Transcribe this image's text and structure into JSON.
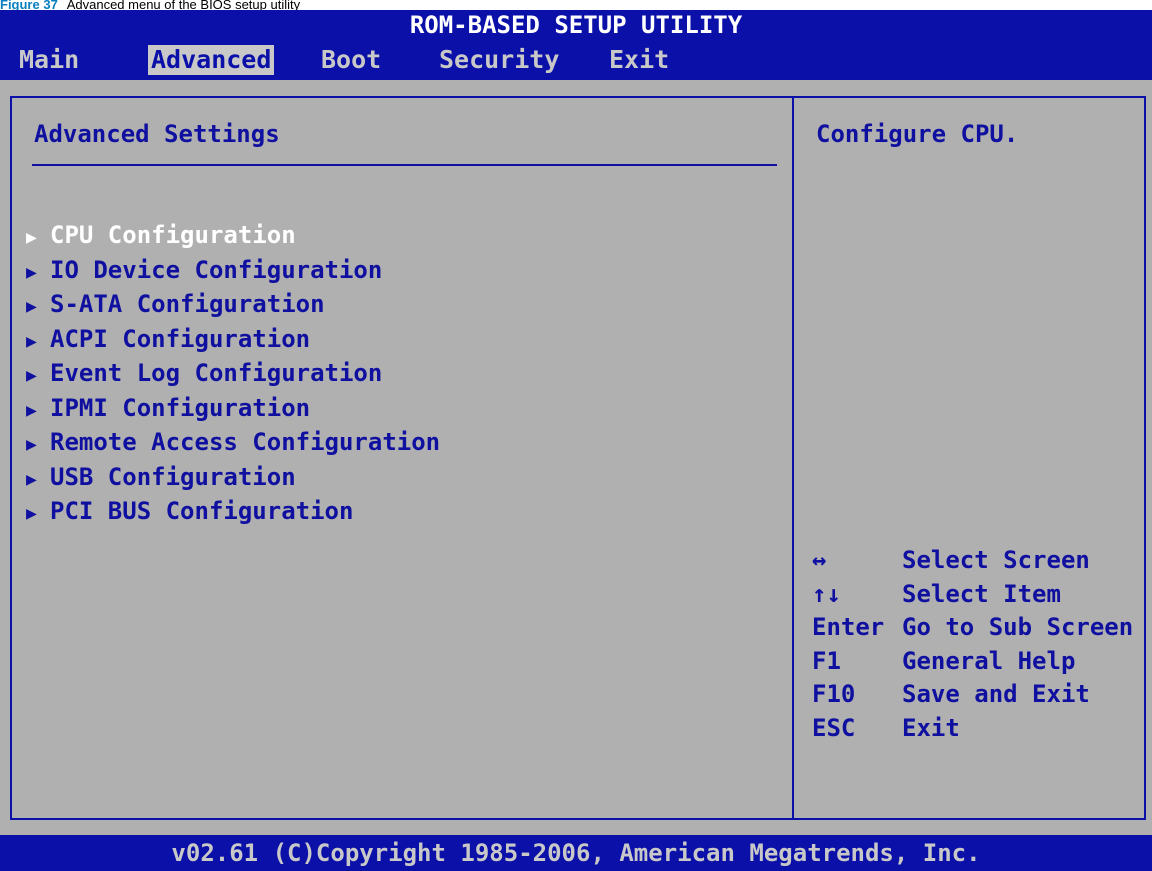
{
  "caption": {
    "label": "Figure 37",
    "text": "Advanced menu of the BIOS setup utility"
  },
  "title": "ROM-BASED SETUP UTILITY",
  "menu": {
    "items": [
      "Main",
      "Advanced",
      "Boot",
      "Security",
      "Exit"
    ],
    "active": "Advanced"
  },
  "main": {
    "section_title": "Advanced Settings",
    "selected_index": 0,
    "items": [
      "CPU Configuration",
      "IO Device Configuration",
      "S-ATA Configuration",
      "ACPI Configuration",
      "Event Log Configuration",
      "IPMI Configuration",
      "Remote Access Configuration",
      "USB Configuration",
      "PCI BUS Configuration"
    ]
  },
  "help": {
    "text": "Configure CPU.",
    "keys": [
      {
        "key": "↔",
        "desc": "Select Screen"
      },
      {
        "key": "↑↓",
        "desc": "Select Item"
      },
      {
        "key": "Enter",
        "desc": "Go to Sub Screen"
      },
      {
        "key": "F1",
        "desc": "General Help"
      },
      {
        "key": "F10",
        "desc": "Save and Exit"
      },
      {
        "key": "ESC",
        "desc": "Exit"
      }
    ]
  },
  "footer": "v02.61 (C)Copyright 1985-2006, American Megatrends, Inc.",
  "colors": {
    "bios_blue": "#0a10a8",
    "panel_gray": "#b0b0b0",
    "text_blue": "#1010a0",
    "highlight_white": "#ffffff",
    "caption_label": "#0a7fc0"
  }
}
